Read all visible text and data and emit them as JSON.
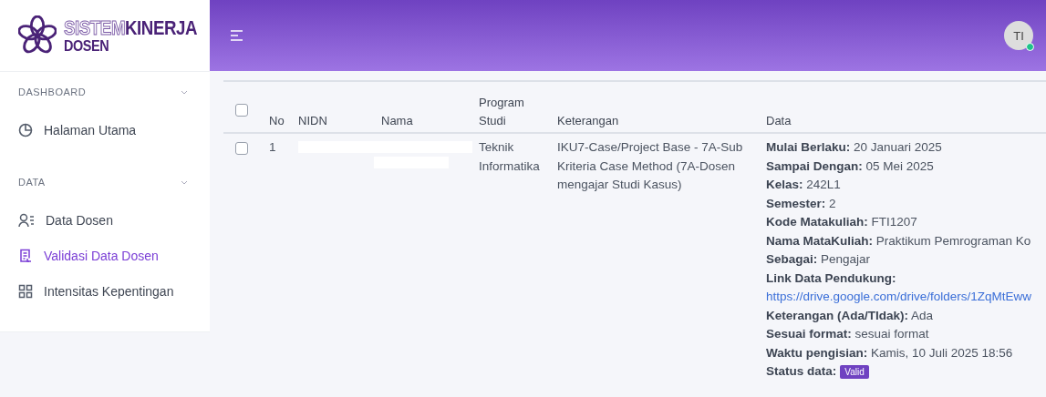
{
  "logo": {
    "outline_text": "SISTEM",
    "text": "KINERJA",
    "subtitle": "DOSEN"
  },
  "sidebar": {
    "sections": [
      {
        "title": "DASHBOARD",
        "expanded": true,
        "items": [
          {
            "label": "Halaman Utama",
            "kind": "pie",
            "selected": false
          }
        ]
      },
      {
        "title": "DATA",
        "expanded": true,
        "items": [
          {
            "label": "Data Dosen",
            "kind": "user-list",
            "selected": false
          },
          {
            "label": "Validasi Data Dosen",
            "kind": "document",
            "selected": true
          },
          {
            "label": "Intensitas Kepentingan",
            "kind": "grid",
            "selected": false
          }
        ]
      }
    ]
  },
  "header": {
    "avatar": {
      "initials": "TI",
      "online": true
    }
  },
  "table": {
    "columns": [
      "No",
      "NIDN",
      "Nama",
      "Program Studi",
      "Keterangan",
      "Data"
    ],
    "header_checked": false,
    "rows": [
      {
        "checked": false,
        "no": "1",
        "redacted_nidn": true,
        "redacted_nama": true,
        "program_studi": "Teknik Informatika",
        "keterangan": "IKU7-Case/Project Base - 7A-Sub Kriteria Case Method (7A-Dosen mengajar Studi Kasus)",
        "data": [
          {
            "kind": "text",
            "label": "Mulai Berlaku:",
            "value": "20 Januari 2025"
          },
          {
            "kind": "text",
            "label": "Sampai Dengan:",
            "value": "05 Mei 2025"
          },
          {
            "kind": "text",
            "label": "Kelas:",
            "value": "242L1"
          },
          {
            "kind": "text",
            "label": "Semester:",
            "value": "2"
          },
          {
            "kind": "text",
            "label": "Kode Matakuliah:",
            "value": "FTI1207"
          },
          {
            "kind": "text",
            "label": "Nama MataKuliah:",
            "value": "Praktikum Pemrograman Ko"
          },
          {
            "kind": "text",
            "label": "Sebagai:",
            "value": "Pengajar"
          },
          {
            "kind": "link",
            "label": "Link Data Pendukung:",
            "value": "https://drive.google.com/drive/folders/1ZqMtEww"
          },
          {
            "kind": "text",
            "label": "Keterangan (Ada/TIdak):",
            "value": "Ada"
          },
          {
            "kind": "text",
            "label": "Sesuai format:",
            "value": "sesuai format"
          },
          {
            "kind": "text",
            "label": "Waktu pengisian:",
            "value": "Kamis, 10 Juli 2025 18:56"
          },
          {
            "kind": "badge",
            "label": "Status data:",
            "value": "Valid"
          }
        ]
      }
    ]
  }
}
